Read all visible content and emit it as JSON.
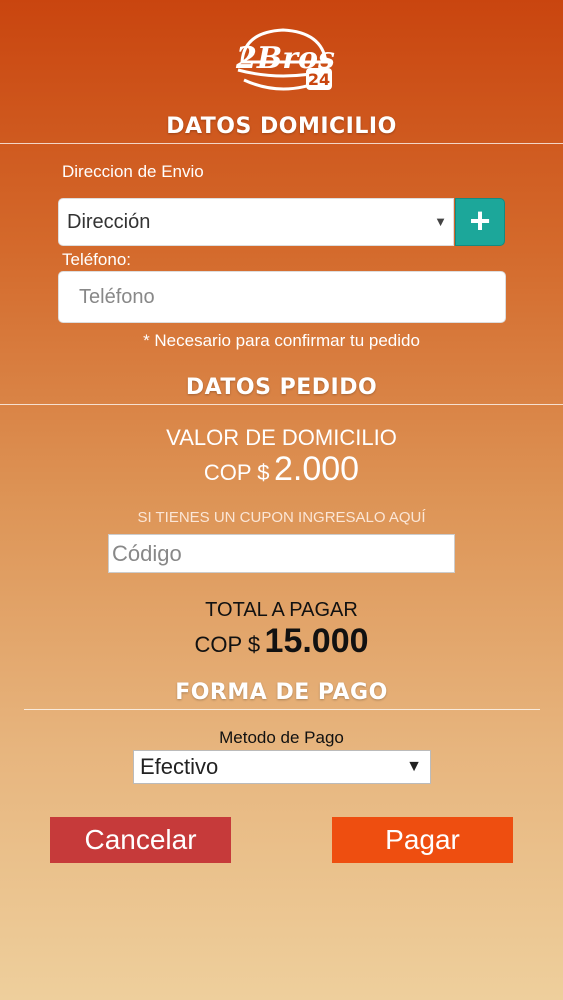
{
  "logo": {
    "text_main": "2Bros",
    "text_badge": "24"
  },
  "sections": {
    "domicilio_title": "DATOS DOMICILIO",
    "pedido_title": "DATOS PEDIDO",
    "pago_title": "FORMA DE PAGO"
  },
  "address": {
    "label": "Direccion de Envio",
    "select_value": "Dirección",
    "caret": "▼",
    "add_icon": "plus-icon",
    "add_symbol": "+"
  },
  "phone": {
    "label": "Teléfono:",
    "placeholder": "Teléfono",
    "note": "* Necesario para confirmar tu pedido"
  },
  "delivery": {
    "label": "VALOR DE DOMICILIO",
    "currency": "COP $",
    "amount": "2.000"
  },
  "coupon": {
    "prompt": "SI TIENES UN CUPON INGRESALO AQUÍ",
    "placeholder": "Código"
  },
  "total": {
    "label": "TOTAL A PAGAR",
    "currency": "COP $",
    "amount": "15.000"
  },
  "payment": {
    "label": "Metodo de Pago",
    "selected": "Efectivo",
    "caret": "▼"
  },
  "buttons": {
    "cancel": "Cancelar",
    "pay": "Pagar"
  },
  "colors": {
    "add_button": "#1ca79a",
    "cancel_button": "#c63a3a",
    "pay_button": "#ee4e10"
  }
}
